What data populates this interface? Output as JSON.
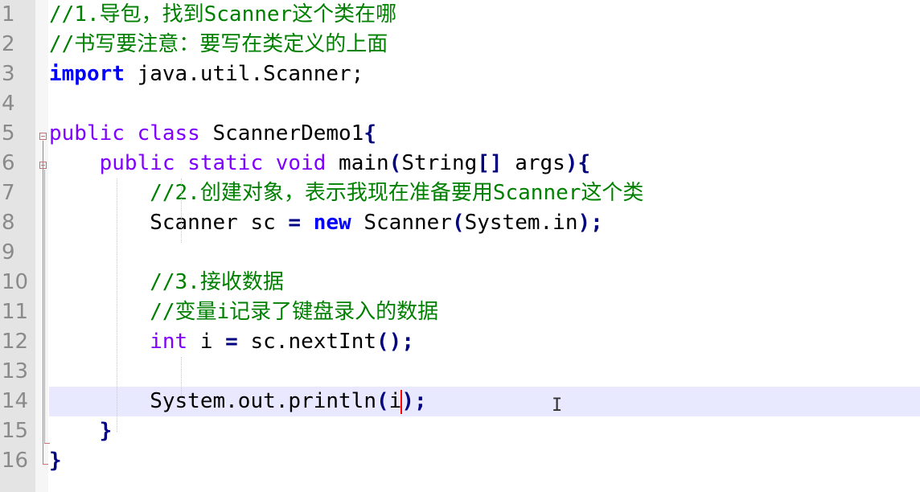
{
  "lines": [
    {
      "n": "1",
      "tokens": [
        {
          "t": "//1.导包，找到Scanner这个类在哪",
          "k": "comment"
        }
      ]
    },
    {
      "n": "2",
      "tokens": [
        {
          "t": "//书写要注意：要写在类定义的上面",
          "k": "comment"
        }
      ]
    },
    {
      "n": "3",
      "tokens": [
        {
          "t": "import",
          "k": "keyword"
        },
        {
          "t": " java.util.Scanner;",
          "k": "plain"
        }
      ]
    },
    {
      "n": "4",
      "tokens": []
    },
    {
      "n": "5",
      "tokens": [
        {
          "t": "public class",
          "k": "decl"
        },
        {
          "t": " ScannerDemo1",
          "k": "plain"
        },
        {
          "t": "{",
          "k": "op"
        }
      ]
    },
    {
      "n": "6",
      "tokens": [
        {
          "t": "    ",
          "k": "plain"
        },
        {
          "t": "public static void",
          "k": "decl"
        },
        {
          "t": " main",
          "k": "plain"
        },
        {
          "t": "(",
          "k": "op"
        },
        {
          "t": "String",
          "k": "plain"
        },
        {
          "t": "[]",
          "k": "op"
        },
        {
          "t": " args",
          "k": "plain"
        },
        {
          "t": "){",
          "k": "op"
        }
      ]
    },
    {
      "n": "7",
      "tokens": [
        {
          "t": "        //2.创建对象，表示我现在准备要用Scanner这个类",
          "k": "comment"
        }
      ]
    },
    {
      "n": "8",
      "tokens": [
        {
          "t": "        Scanner sc ",
          "k": "plain"
        },
        {
          "t": "=",
          "k": "op"
        },
        {
          "t": " ",
          "k": "plain"
        },
        {
          "t": "new",
          "k": "keyword"
        },
        {
          "t": " Scanner",
          "k": "plain"
        },
        {
          "t": "(",
          "k": "op"
        },
        {
          "t": "System.in",
          "k": "plain"
        },
        {
          "t": ");",
          "k": "op"
        }
      ]
    },
    {
      "n": "9",
      "tokens": []
    },
    {
      "n": "10",
      "tokens": [
        {
          "t": "        //3.接收数据",
          "k": "comment"
        }
      ]
    },
    {
      "n": "11",
      "tokens": [
        {
          "t": "        //变量i记录了键盘录入的数据",
          "k": "comment"
        }
      ]
    },
    {
      "n": "12",
      "tokens": [
        {
          "t": "        ",
          "k": "plain"
        },
        {
          "t": "int",
          "k": "decl"
        },
        {
          "t": " i ",
          "k": "plain"
        },
        {
          "t": "=",
          "k": "op"
        },
        {
          "t": " sc.nextInt",
          "k": "plain"
        },
        {
          "t": "();",
          "k": "op"
        }
      ]
    },
    {
      "n": "13",
      "tokens": []
    },
    {
      "n": "14",
      "current": true,
      "tokens": [
        {
          "t": "        System.out.println",
          "k": "plain"
        },
        {
          "t": "(",
          "k": "op"
        },
        {
          "t": "i",
          "k": "plain"
        },
        {
          "t": "CARET",
          "k": "caret"
        },
        {
          "t": ")",
          "k": "op"
        },
        {
          "t": ";",
          "k": "op"
        }
      ]
    },
    {
      "n": "15",
      "tokens": [
        {
          "t": "    ",
          "k": "plain"
        },
        {
          "t": "}",
          "k": "op"
        }
      ]
    },
    {
      "n": "16",
      "tokens": [
        {
          "t": "}",
          "k": "op"
        }
      ]
    }
  ],
  "colors": {
    "comment": "#008000",
    "keyword": "#0000ff",
    "decl": "#8000ff",
    "current_line": "#e8e8ff",
    "gutter": "#e4e4e4"
  }
}
